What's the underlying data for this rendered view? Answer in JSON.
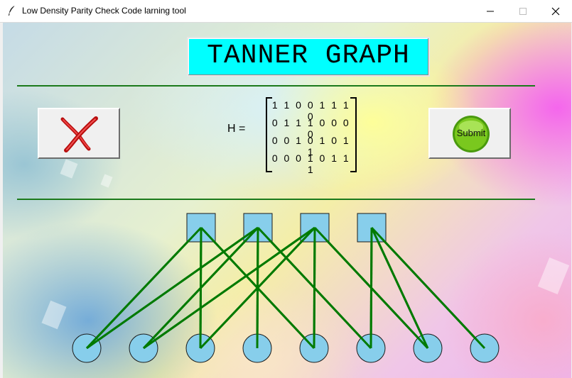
{
  "window": {
    "title": "Low Density Parity Check Code larning tool",
    "icons": [
      "feather-icon",
      "minimize-icon",
      "maximize-icon",
      "close-icon"
    ]
  },
  "header": {
    "title": "TANNER GRAPH",
    "background_color": "#00ffff"
  },
  "buttons": {
    "cancel": {
      "icon": "red-x-icon"
    },
    "submit": {
      "label": "Submit",
      "color": "#6cc417"
    }
  },
  "matrix": {
    "label": "H  =",
    "rows": [
      "1 1 0 0 1 1 1 0",
      "0 1 1 1 0 0 0 0",
      "0 0 1 0 1 0 1 1",
      "0 0 0 1 0 1 1 1"
    ],
    "values": [
      [
        1,
        1,
        0,
        0,
        1,
        1,
        1,
        0
      ],
      [
        0,
        1,
        1,
        1,
        0,
        0,
        0,
        0
      ],
      [
        0,
        0,
        1,
        0,
        1,
        0,
        1,
        1
      ],
      [
        0,
        0,
        0,
        1,
        0,
        1,
        1,
        1
      ]
    ]
  },
  "graph": {
    "check_nodes": 4,
    "variable_nodes": 8,
    "edges": [
      [
        0,
        0
      ],
      [
        0,
        2
      ],
      [
        0,
        4
      ],
      [
        1,
        0
      ],
      [
        1,
        1
      ],
      [
        1,
        3
      ],
      [
        1,
        5
      ],
      [
        2,
        1
      ],
      [
        2,
        2
      ],
      [
        2,
        4
      ],
      [
        2,
        6
      ],
      [
        3,
        5
      ],
      [
        3,
        6
      ],
      [
        3,
        7
      ]
    ],
    "node_color": "#87ceeb",
    "edge_color": "#007a00"
  }
}
